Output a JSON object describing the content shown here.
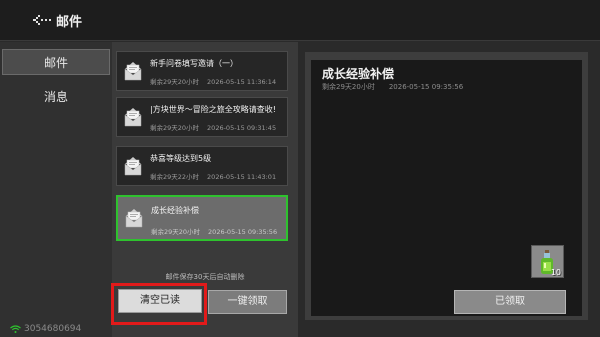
{
  "header": {
    "title": "邮件",
    "back_icon": "back-arrow-icon"
  },
  "sidebar": {
    "tabs": [
      {
        "label": "邮件",
        "active": true
      },
      {
        "label": "消息",
        "active": false
      }
    ],
    "status": {
      "icon": "wifi-icon",
      "text": "3054680694"
    }
  },
  "mail_list": {
    "items": [
      {
        "title": "新手问卷填写邀请（一）",
        "remaining": "剩余29天20小时",
        "date": "2026-05-15 11:36:14"
      },
      {
        "title": "|方块世界～冒险之旅全攻略请查收!",
        "remaining": "剩余29天20小时",
        "date": "2026-05-15 09:31:45"
      },
      {
        "title": "恭喜等级达到5级",
        "remaining": "剩余29天22小时",
        "date": "2026-05-15 11:43:01"
      },
      {
        "title": "成长经验补偿",
        "remaining": "剩余29天20小时",
        "date": "2026-05-15 09:35:56",
        "selected": true
      }
    ],
    "note": "邮件保存30天后自动删除",
    "clear_read_label": "清空已读",
    "claim_all_label": "一键领取"
  },
  "detail": {
    "title": "成长经验补偿",
    "remaining": "剩余29天20小时",
    "date": "2026-05-15 09:35:56",
    "reward": {
      "icon": "experience-bottle-icon",
      "count": "10"
    },
    "claimed_label": "已领取"
  },
  "colors": {
    "selected_border": "#2ec22e",
    "highlight": "#e21a1a"
  }
}
